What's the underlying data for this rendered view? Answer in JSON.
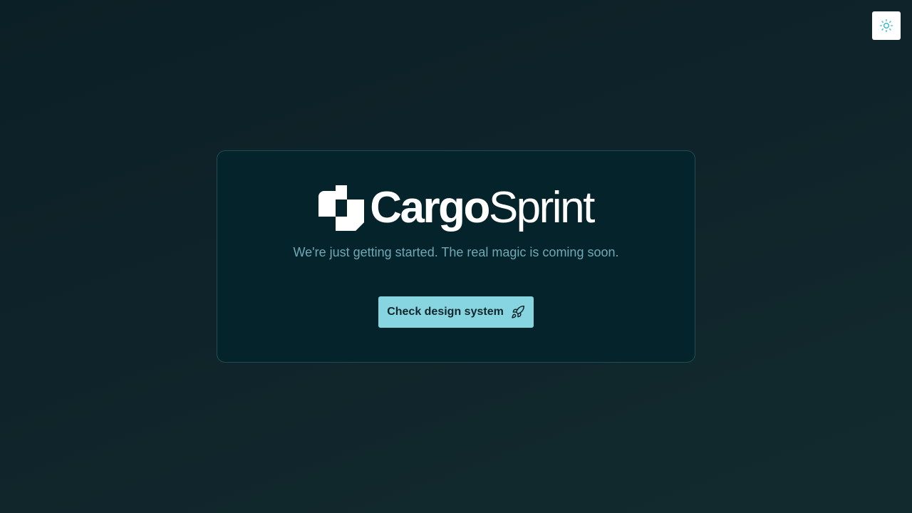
{
  "brand": {
    "name_bold": "Cargo",
    "name_light": "Sprint"
  },
  "tagline": "We're just getting started. The real magic is coming soon.",
  "cta": {
    "label": "Check design system",
    "icon": "rocket-icon"
  },
  "theme_toggle": {
    "icon": "sun-icon"
  },
  "colors": {
    "background": "#0d2328",
    "card": "#04232a",
    "card_border": "#1f4d55",
    "tagline": "#6fa9b6",
    "button": "#87d5e0",
    "button_text": "#10262b",
    "logo": "#ffffff"
  }
}
